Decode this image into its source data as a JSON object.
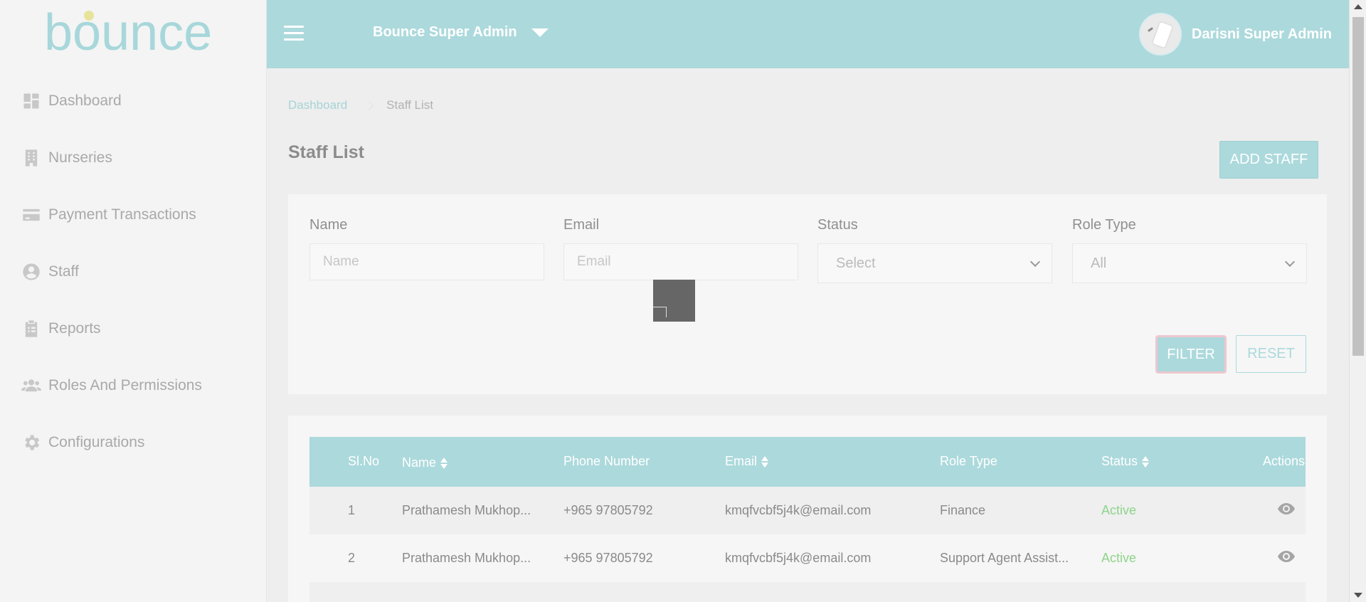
{
  "brand": {
    "logo_text": "bounce"
  },
  "sidebar": {
    "items": [
      {
        "label": "Dashboard",
        "icon": "dashboard-icon"
      },
      {
        "label": "Nurseries",
        "icon": "building-icon"
      },
      {
        "label": "Payment Transactions",
        "icon": "credit-card-icon"
      },
      {
        "label": "Staff",
        "icon": "user-circle-icon"
      },
      {
        "label": "Reports",
        "icon": "clipboard-icon"
      },
      {
        "label": "Roles And Permissions",
        "icon": "users-icon"
      },
      {
        "label": "Configurations",
        "icon": "gear-icon"
      }
    ]
  },
  "header": {
    "admin_switch": "Bounce Super Admin",
    "user_name": "Darisni Super Admin"
  },
  "breadcrumb": {
    "home": "Dashboard",
    "current": "Staff List"
  },
  "page": {
    "title": "Staff List",
    "add_button": "ADD STAFF"
  },
  "filters": {
    "name": {
      "label": "Name",
      "placeholder": "Name"
    },
    "email": {
      "label": "Email",
      "placeholder": "Email"
    },
    "status": {
      "label": "Status",
      "value": "Select"
    },
    "role_type": {
      "label": "Role Type",
      "value": "All"
    },
    "filter_button": "FILTER",
    "reset_button": "RESET"
  },
  "table": {
    "columns": [
      "Sl.No",
      "Name",
      "Phone Number",
      "Email",
      "Role Type",
      "Status",
      "Actions"
    ],
    "rows": [
      {
        "sl": "1",
        "name": "Prathamesh Mukhop...",
        "phone": "+965 97805792",
        "email": "kmqfvcbf5j4k@email.com",
        "role": "Finance",
        "status": "Active"
      },
      {
        "sl": "2",
        "name": "Prathamesh Mukhop...",
        "phone": "+965 97805792",
        "email": "kmqfvcbf5j4k@email.com",
        "role": "Support Agent Assist...",
        "status": "Active"
      }
    ]
  },
  "colors": {
    "accent": "#acd9dc",
    "active": "#8ed48a",
    "sidebar_bg": "#f4f4f4"
  }
}
